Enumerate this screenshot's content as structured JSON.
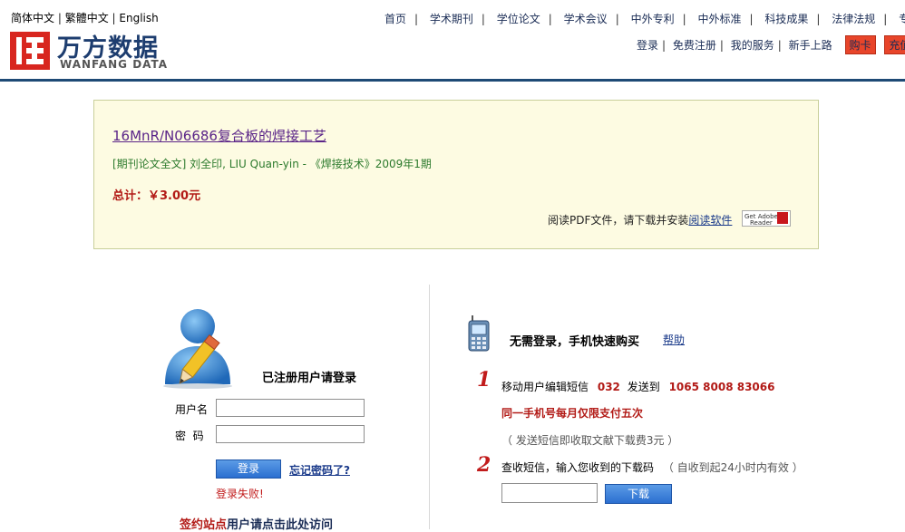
{
  "header": {
    "lang": [
      "简体中文",
      "繁體中文",
      "English"
    ],
    "logo_cn": "万方数据",
    "logo_en": "WANFANG DATA",
    "nav": [
      "首页",
      "学术期刊",
      "学位论文",
      "学术会议",
      "中外专利",
      "中外标准",
      "科技成果",
      "法律法规",
      "专题"
    ],
    "user_links": [
      "登录",
      "免费注册",
      "我的服务",
      "新手上路"
    ],
    "buy_card": "购卡",
    "recharge": "充值"
  },
  "order": {
    "title": "16MnR/N06686复合板的焊接工艺",
    "meta": "[期刊论文全文]  刘全印, LIU Quan-yin - 《焊接技术》2009年1期",
    "total": "总计：￥3.00元",
    "pdf_text": "阅读PDF文件，请下载并安装",
    "pdf_link": "阅读软件",
    "adobe_line1": "Get Adobe",
    "adobe_line2": "Reader"
  },
  "login": {
    "heading": "已注册用户请登录",
    "username_label": "用户名",
    "password_label": "密  码",
    "username_value": "",
    "password_value": "",
    "login_button": "登录",
    "forgot": "忘记密码了?",
    "fail": "登录失败!",
    "sign_visit_red": "签约站点",
    "sign_visit_rest": "用户请点击此处访问"
  },
  "sms": {
    "heading": "无需登录，手机快速购买",
    "help": "帮助",
    "step1_num": "1",
    "step1_a": "移动用户编辑短信",
    "step1_code": "032",
    "step1_b": "发送到",
    "step1_phone": "1065 8008 83066",
    "limit": "同一手机号每月仅限支付五次",
    "note": "（ 发送短信即收取文献下载费3元 ）",
    "step2_num": "2",
    "step2_text": "查收短信，输入您收到的下载码",
    "step2_note": "（ 自收到起24小时内有效 ）",
    "download_code_value": "",
    "download_button": "下载"
  }
}
